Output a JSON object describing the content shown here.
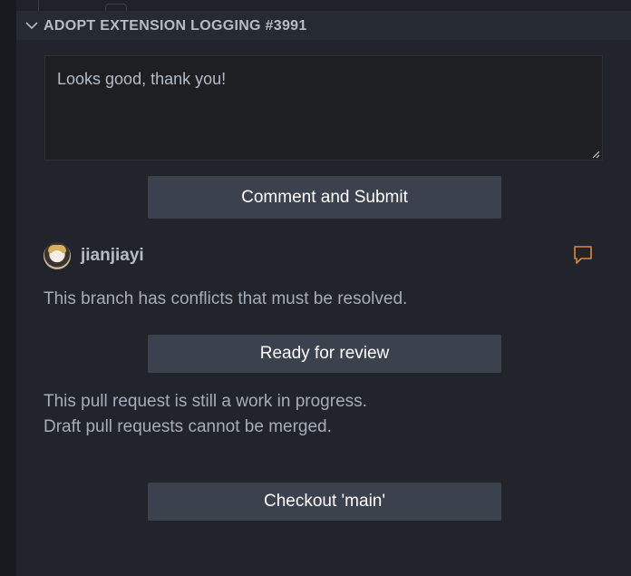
{
  "section": {
    "title": "ADOPT EXTENSION LOGGING #3991"
  },
  "comment": {
    "value": "Looks good, thank you!"
  },
  "buttons": {
    "comment_submit": "Comment and Submit",
    "ready_for_review": "Ready for review",
    "checkout": "Checkout 'main'"
  },
  "user": {
    "name": "jianjiayi"
  },
  "status": {
    "conflict": "This branch has conflicts that must be resolved.",
    "wip_line1": "This pull request is still a work in progress.",
    "wip_line2": "Draft pull requests cannot be merged."
  },
  "icons": {
    "section_toggle": "chevron-down-icon",
    "comment": "comment-icon",
    "avatar": "avatar"
  },
  "colors": {
    "accent_comment_icon": "#e0873a",
    "button_bg": "#3b414d",
    "panel_bg": "#21252b"
  }
}
